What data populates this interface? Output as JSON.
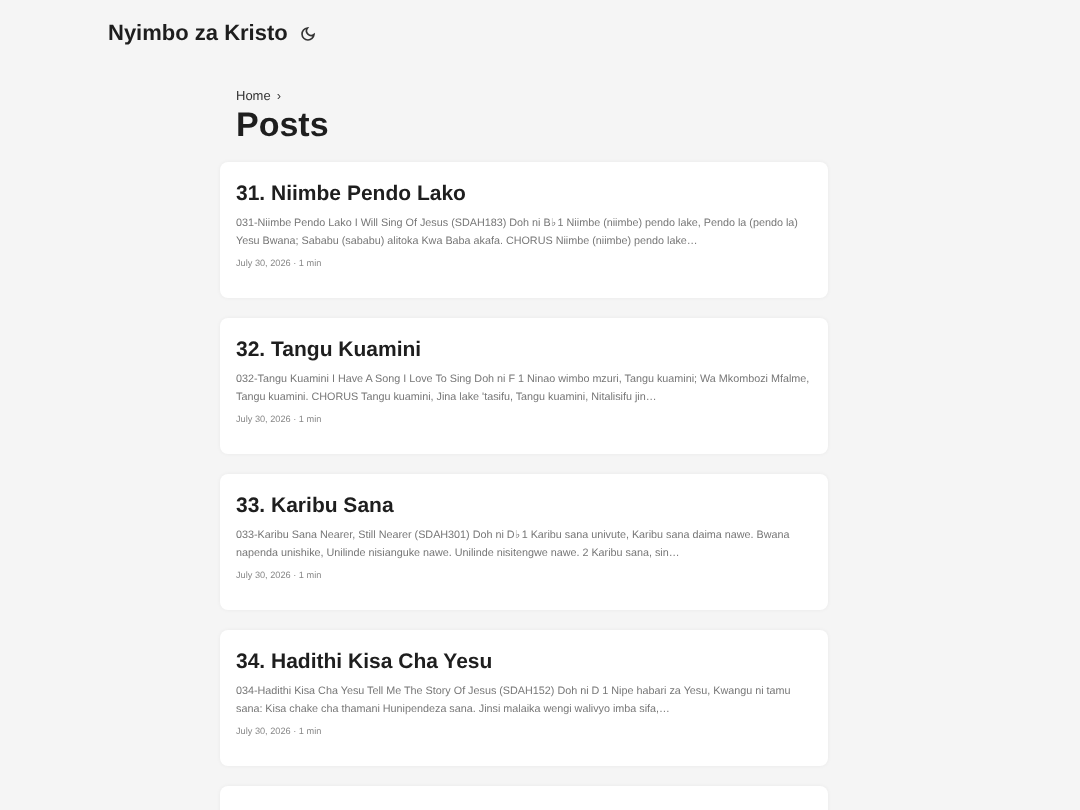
{
  "header": {
    "site_title": "Nyimbo za Kristo"
  },
  "breadcrumb": {
    "items": [
      "Home"
    ],
    "separator": "›"
  },
  "page_title": "Posts",
  "posts": [
    {
      "title": "31. Niimbe Pendo Lako",
      "excerpt": "031-Niimbe Pendo Lako I Will Sing Of Jesus (SDAH183) Doh ni B♭ 1 Niimbe (niimbe) pendo lake, Pendo la (pendo la) Yesu Bwana; Sababu (sababu) alitoka Kwa Baba akafa. CHORUS Niimbe (niimbe) pendo lake…",
      "meta": "July 30, 2026 · 1 min"
    },
    {
      "title": "32. Tangu Kuamini",
      "excerpt": "032-Tangu Kuamini I Have A Song I Love To Sing Doh ni F 1 Ninao wimbo mzuri, Tangu kuamini; Wa Mkombozi Mfalme, Tangu kuamini. CHORUS Tangu kuamini, Jina lake 'tasifu, Tangu kuamini, Nitalisifu jin…",
      "meta": "July 30, 2026 · 1 min"
    },
    {
      "title": "33. Karibu Sana",
      "excerpt": "033-Karibu Sana Nearer, Still Nearer (SDAH301) Doh ni D♭ 1 Karibu sana univute, Karibu sana daima nawe. Bwana napenda unishike, Unilinde nisianguke nawe. Unilinde nisitengwe nawe. 2 Karibu sana, sin…",
      "meta": "July 30, 2026 · 1 min"
    },
    {
      "title": "34. Hadithi Kisa Cha Yesu",
      "excerpt": "034-Hadithi Kisa Cha Yesu Tell Me The Story Of Jesus (SDAH152) Doh ni D 1 Nipe habari za Yesu, Kwangu ni tamu sana: Kisa chake cha thamani Hunipendeza sana. Jinsi malaika wengi walivyo imba sifa,…",
      "meta": "July 30, 2026 · 1 min"
    }
  ]
}
